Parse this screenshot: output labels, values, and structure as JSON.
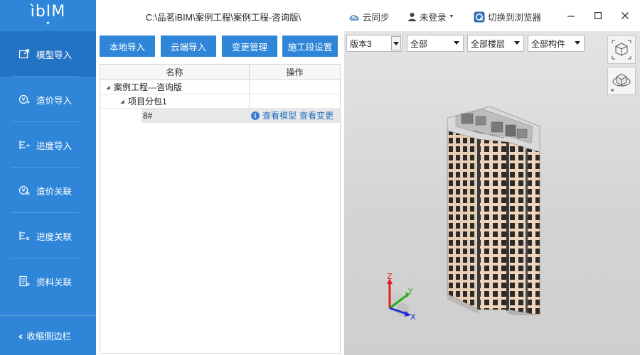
{
  "app": {
    "logo": "ìbIM",
    "title_path": "C:\\品茗iBIM\\案例工程\\案例工程-咨询版\\"
  },
  "header": {
    "cloud_sync": "云同步",
    "user": "未登录",
    "switch_browser": "切换到浏览器"
  },
  "sidebar": {
    "items": [
      {
        "label": "模型导入",
        "icon": "model-import-icon",
        "active": true
      },
      {
        "label": "造价导入",
        "icon": "cost-import-icon"
      },
      {
        "label": "进度导入",
        "icon": "progress-import-icon"
      },
      {
        "label": "造价关联",
        "icon": "cost-link-icon"
      },
      {
        "label": "进度关联",
        "icon": "progress-link-icon"
      },
      {
        "label": "资料关联",
        "icon": "document-link-icon"
      }
    ],
    "collapse": "收缩侧边栏"
  },
  "toolbar": {
    "local_import": "本地导入",
    "cloud_import": "云端导入",
    "change_mgmt": "变更管理",
    "stage_settings": "施工段设置"
  },
  "tree": {
    "headers": {
      "name": "名称",
      "operation": "操作"
    },
    "rows": [
      {
        "name": "案例工程---咨询版"
      },
      {
        "name": "项目分包1"
      },
      {
        "name": "8#",
        "view_model": "查看模型",
        "view_change": "查看变更"
      }
    ]
  },
  "viewer": {
    "version": "版本3",
    "filter_all": "全部",
    "floors": "全部楼层",
    "components": "全部构件",
    "axes": {
      "x": "X",
      "y": "Y",
      "z": "Z"
    }
  },
  "colors": {
    "sidebar": "#2f86d8",
    "sidebar_active": "#2373c4",
    "button": "#2f86d8",
    "link": "#1f6fbf"
  }
}
